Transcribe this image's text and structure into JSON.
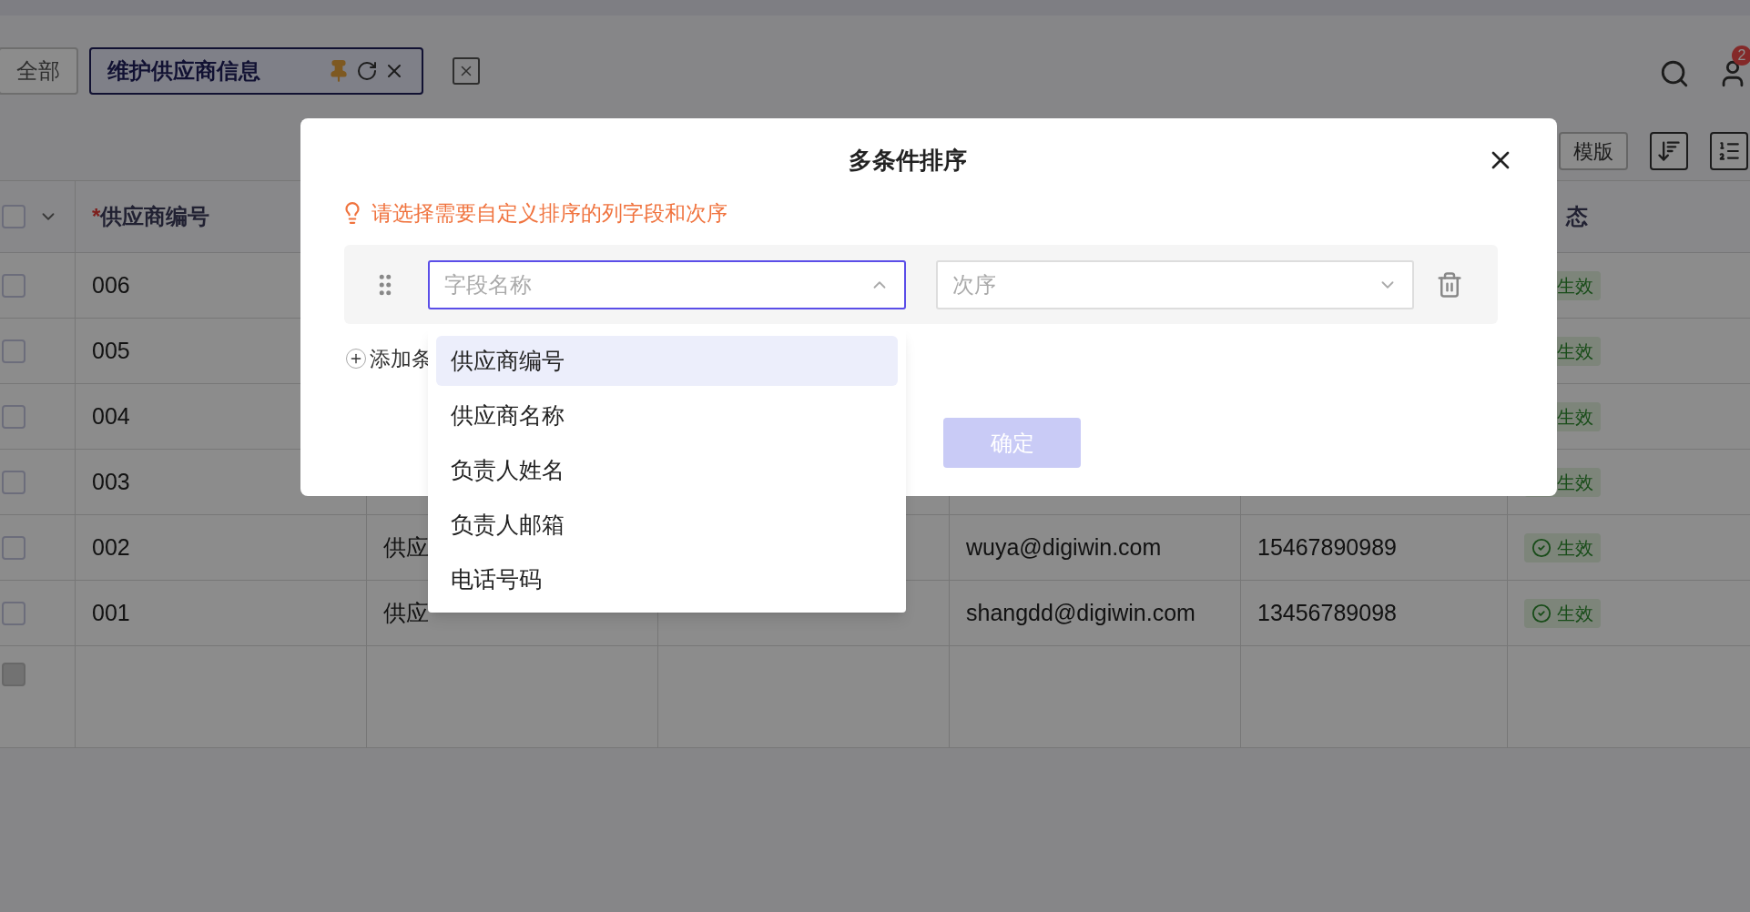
{
  "top_tabs": [
    {
      "label": "全部",
      "selected": false
    },
    {
      "label": "维护供应商信息",
      "selected": true,
      "pinned": true
    }
  ],
  "notification_badge": "2",
  "toolbar": {
    "template_button": "模版"
  },
  "table": {
    "header_checkbox": {
      "checked": false
    },
    "header": {
      "column_1": {
        "mark": "*",
        "label": "供应商编号"
      },
      "column_6": {
        "label": "态"
      }
    },
    "rows": [
      {
        "checked": false,
        "code": "006",
        "status": "生效"
      },
      {
        "checked": false,
        "code": "005",
        "status": "生效"
      },
      {
        "checked": false,
        "code": "004",
        "status": "生效"
      },
      {
        "checked": false,
        "code": "003",
        "status": "生效"
      },
      {
        "checked": false,
        "code": "002",
        "name": "供应",
        "email": "wuya@digiwin.com",
        "phone": "15467890989",
        "status": "生效",
        "status_icon": true
      },
      {
        "checked": false,
        "code": "001",
        "name": "供应",
        "email": "shangdd@digiwin.com",
        "phone": "13456789098",
        "status": "生效",
        "status_icon": true
      },
      {
        "disabled": true
      }
    ]
  },
  "dialog": {
    "title": "多条件排序",
    "hint": "请选择需要自定义排序的列字段和次序",
    "conditions": [
      {
        "field_placeholder": "字段名称",
        "order_placeholder": "次序",
        "expanded": true
      }
    ],
    "add_button": "添加条",
    "confirm_button": {
      "label": "确定",
      "disabled": true
    },
    "dropdown_options": [
      {
        "label": "供应商编号",
        "selected": true
      },
      {
        "label": "供应商名称",
        "selected": false
      },
      {
        "label": "负责人姓名",
        "selected": false
      },
      {
        "label": "负责人邮箱",
        "selected": false
      },
      {
        "label": "电话号码",
        "selected": false
      }
    ]
  }
}
